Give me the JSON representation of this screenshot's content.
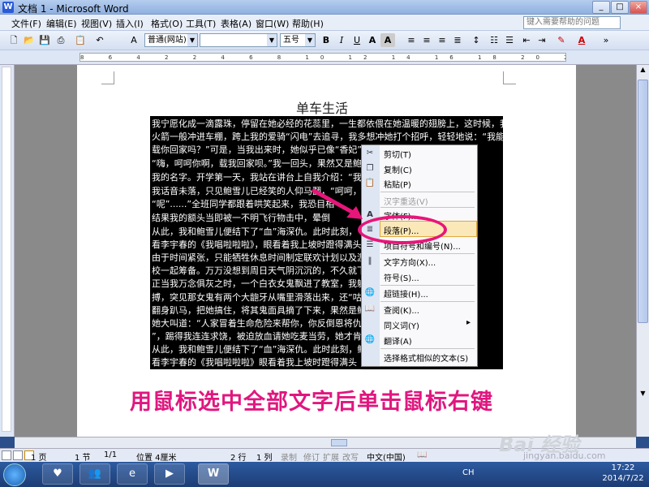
{
  "window": {
    "title": "文档 1 - Microsoft Word",
    "min": "_",
    "max": "□",
    "close": "×"
  },
  "menu": {
    "items": [
      "文件(F)",
      "编辑(E)",
      "视图(V)",
      "插入(I)",
      "格式(O)",
      "工具(T)",
      "表格(A)",
      "窗口(W)",
      "帮助(H)"
    ],
    "help_placeholder": "键入需要帮助的问题"
  },
  "toolbar": {
    "style_value": "普通(网站)",
    "font_value": "",
    "size_value": "五号",
    "bold": "B",
    "italic": "I",
    "underline": "U",
    "char_a": "A"
  },
  "ruler": {
    "marks": "8 6 4 2 2 4 6 8 10 12 14 16 18 20 22 24 26 28 30 32 34 36 38 40 42 44 46 48"
  },
  "document": {
    "title": "单车生活",
    "lines": [
      "我宁愿化成一滴露珠，停留在她必经的花蕊里，一生都依偎在她温暖的翅膀上，这时候，我",
      "火箭一般冲进车棚，跨上我的爱骑“闪电”去追寻，我多想冲她打个招呼，轻轻地说：“我能",
      "载你回家吗？”可是，当我出来时，她似乎已像“香妃”",
      "“嗨，呵呵你啊，载我回家呗。”我一回头，果然又是鲍",
      "我的名字。开学第一天，我站在讲台上自我介绍：“我叫",
      "我话音未落，只见鲍雪儿已经笑的人仰马翻，“呵呵，竟",
      "“呢”......”全班同学都跟着哄笑起来，我恐目相",
      "结果我的额头当即被一不明飞行物击中，晕倒",
      "从此，我和鲍雪儿便结下了“血”海深仇。此时此刻，",
      "看李宇春的《我唱啦啦啦》，眼看着我上坡时蹬得满头",
      "由于时间紧张，只能牺牲休息时间制定联欢计划以及游",
      "校一起筹备。万万没想到周日天气阴沉沉的，不久就下",
      "正当我万念俱灰之时，一个白衣女鬼飘进了教室，我躲",
      "搏，突见那女鬼有两个大龅牙从嘴里滑落出来，还“咕",
      "翻身趴马，把她搞住，将其鬼面具摘了下来，果然是鲍",
      "她大叫道：“人家冒着生命危险来帮你，你反倒恩将仇",
      "”，踢得我连连求饶，被迫放血请她吃麦当劳，她才肯",
      "从此，我和鲍雪儿便结下了“血”海深仇。此时此刻，鲍",
      "看李宇春的《我唱啦啦啦》眼看着我上坡时蹬得满头"
    ]
  },
  "context_menu": {
    "items": [
      {
        "label": "剪切(T)",
        "icon": "scissors-icon",
        "glyph": "✂",
        "disabled": false
      },
      {
        "label": "复制(C)",
        "icon": "copy-icon",
        "glyph": "❐",
        "disabled": false
      },
      {
        "label": "粘贴(P)",
        "icon": "paste-icon",
        "glyph": "📋",
        "disabled": false
      },
      {
        "label": "汉字重选(V)",
        "icon": "",
        "glyph": "",
        "disabled": true
      },
      {
        "label": "字体(F)...",
        "icon": "font-icon",
        "glyph": "A",
        "disabled": false
      },
      {
        "label": "段落(P)...",
        "icon": "paragraph-icon",
        "glyph": "≣",
        "disabled": false
      },
      {
        "label": "项目符号和编号(N)...",
        "icon": "bullets-icon",
        "glyph": "☰",
        "disabled": false
      },
      {
        "label": "文字方向(X)...",
        "icon": "text-direction-icon",
        "glyph": "‖",
        "disabled": false
      },
      {
        "label": "符号(S)...",
        "icon": "",
        "glyph": "",
        "disabled": false
      },
      {
        "label": "超链接(H)...",
        "icon": "hyperlink-icon",
        "glyph": "🌐",
        "disabled": false
      },
      {
        "label": "查阅(K)...",
        "icon": "lookup-icon",
        "glyph": "📖",
        "disabled": false
      },
      {
        "label": "同义词(Y)",
        "icon": "",
        "glyph": "",
        "disabled": false,
        "submenu": "▸"
      },
      {
        "label": "翻译(A)",
        "icon": "translate-icon",
        "glyph": "🌐",
        "disabled": false
      },
      {
        "label": "选择格式相似的文本(S)",
        "icon": "",
        "glyph": "",
        "disabled": false
      }
    ]
  },
  "caption": "用鼠标选中全部文字后单击鼠标右键",
  "status": {
    "page": "1 页",
    "section": "1 节",
    "pages": "1/1",
    "position": "位置 4厘米",
    "row": "2 行",
    "col": "1 列",
    "rec": "录制",
    "trk": "修订",
    "ext": "扩展",
    "ovr": "改写",
    "lang": "中文(中国)"
  },
  "taskbar": {
    "time": "17:22",
    "date": "2014/7/22",
    "word": "W",
    "ime": "CH"
  },
  "watermark": {
    "brand": "Bai 经验",
    "url": "jingyan.baidu.com"
  }
}
